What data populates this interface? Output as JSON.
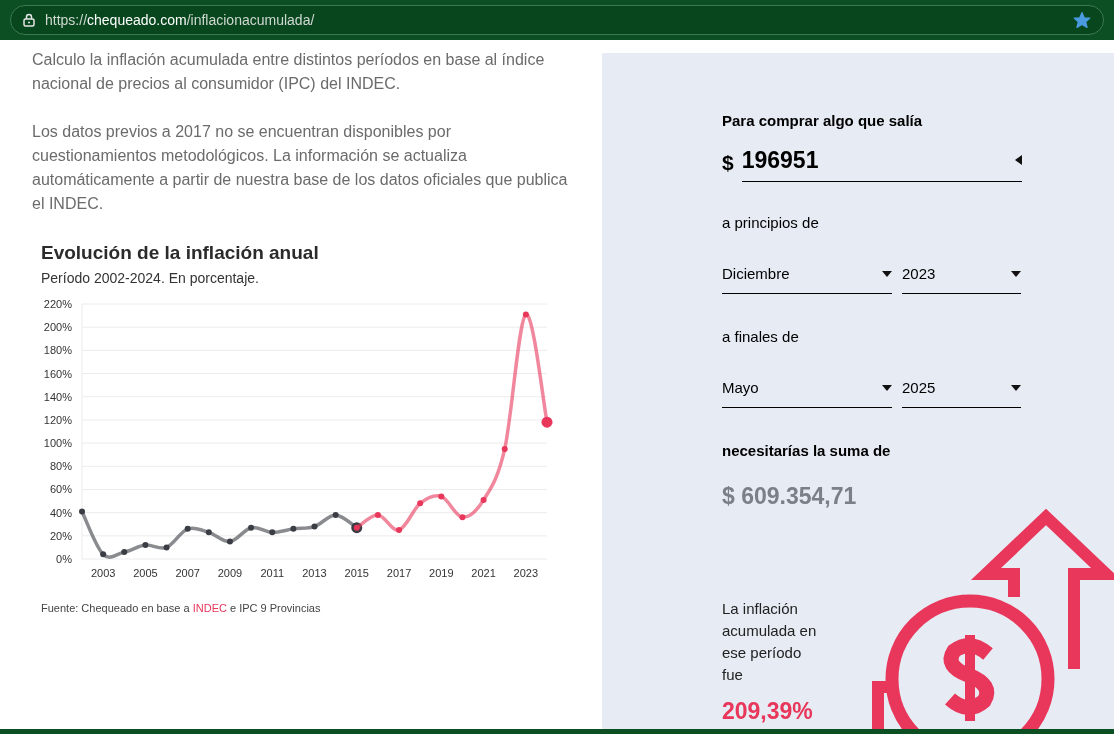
{
  "browser": {
    "url": {
      "scheme": "https://",
      "domain": "chequeado.com",
      "path": "/inflacionacumulada/"
    },
    "bookmarked": true
  },
  "intro": [
    "Calculo la inflación acumulada entre distintos períodos en base al índice nacional de precios al consumidor (IPC) del INDEC.",
    "Los datos previos a 2017 no se encuentran disponibles por cuestionamientos metodológicos. La información se actualiza automáticamente a partir de nuestra base de los datos oficiales que publica el INDEC."
  ],
  "chart": {
    "title": "Evolución de la inflación anual",
    "subtitle": "Período 2002-2024. En porcentaje.",
    "source": {
      "prefix": "Fuente: Chequeado en base a ",
      "link": "INDEC",
      "suffix": " e IPC 9 Provincias"
    },
    "chart_data": {
      "type": "line",
      "x": [
        2002,
        2003,
        2004,
        2005,
        2006,
        2007,
        2008,
        2009,
        2010,
        2011,
        2012,
        2013,
        2014,
        2015,
        2016,
        2017,
        2018,
        2019,
        2020,
        2021,
        2022,
        2023,
        2024
      ],
      "series": [
        {
          "color": "#3a3d44",
          "marker": true,
          "values": [
            41,
            4,
            6,
            12,
            10,
            26,
            23,
            15,
            27,
            23,
            26,
            28,
            38,
            27,
            null,
            null,
            null,
            null,
            null,
            null,
            null,
            null,
            null
          ]
        },
        {
          "color": "#e8375a",
          "marker": true,
          "values": [
            null,
            null,
            null,
            null,
            null,
            null,
            null,
            null,
            null,
            null,
            null,
            null,
            null,
            27,
            38,
            25,
            48,
            54,
            36,
            51,
            95,
            211,
            118
          ]
        }
      ],
      "xlim": [
        2002,
        2024
      ],
      "ylim": [
        0,
        220
      ],
      "grid": true,
      "xticks": [
        2003,
        2005,
        2007,
        2009,
        2011,
        2013,
        2015,
        2017,
        2019,
        2021,
        2023
      ],
      "yticks": [
        {
          "value": 0,
          "label": "0%"
        },
        {
          "value": 20,
          "label": "20%"
        },
        {
          "value": 40,
          "label": "40%"
        },
        {
          "value": 60,
          "label": "60%"
        },
        {
          "value": 80,
          "label": "80%"
        },
        {
          "value": 100,
          "label": "100%"
        },
        {
          "value": 120,
          "label": "120%"
        },
        {
          "value": 140,
          "label": "140%"
        },
        {
          "value": 160,
          "label": "160%"
        },
        {
          "value": 180,
          "label": "180%"
        },
        {
          "value": 200,
          "label": "200%"
        },
        {
          "value": 220,
          "label": "220%"
        }
      ]
    }
  },
  "calculator": {
    "amount_label": "Para comprar algo que salía",
    "currency": "$",
    "amount": "196951",
    "start_label": "a principios de",
    "start_month": "Diciembre",
    "start_year": "2023",
    "end_label": "a finales de",
    "end_month": "Mayo",
    "end_year": "2025",
    "result_label": "necesitarías la suma de",
    "result": "$ 609.354,71",
    "summary": "La inflación acumulada en ese período fue",
    "summary_value": "209,39%"
  }
}
